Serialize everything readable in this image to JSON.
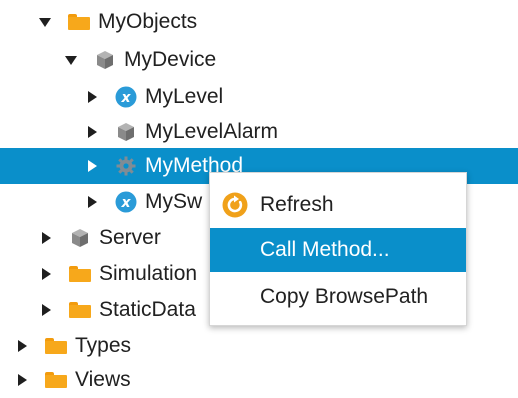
{
  "tree": {
    "items": [
      {
        "label": "MyObjects",
        "icon": "folder-icon",
        "expanded": true
      },
      {
        "label": "MyDevice",
        "icon": "object-cube-icon",
        "expanded": true
      },
      {
        "label": "MyLevel",
        "icon": "variable-icon",
        "expanded": false
      },
      {
        "label": "MyLevelAlarm",
        "icon": "object-cube-icon",
        "expanded": false
      },
      {
        "label": "MyMethod",
        "icon": "method-gear-icon",
        "expanded": false,
        "selected": true
      },
      {
        "label": "MySw",
        "icon": "variable-icon",
        "expanded": false
      },
      {
        "label": "Server",
        "icon": "object-cube-icon",
        "expanded": false
      },
      {
        "label": "Simulation",
        "icon": "folder-icon",
        "expanded": false
      },
      {
        "label": "StaticData",
        "icon": "folder-icon",
        "expanded": false
      },
      {
        "label": "Types",
        "icon": "folder-icon",
        "expanded": false
      },
      {
        "label": "Views",
        "icon": "folder-icon",
        "expanded": false
      }
    ]
  },
  "context_menu": {
    "items": [
      {
        "label": "Refresh",
        "icon": "refresh-icon"
      },
      {
        "label": "Call Method...",
        "highlighted": true
      },
      {
        "label": "Copy BrowsePath"
      }
    ]
  },
  "colors": {
    "selection": "#0a8fca",
    "folder": "#f7a81b",
    "variable": "#2a9bd8",
    "refresh": "#f0a11a"
  }
}
